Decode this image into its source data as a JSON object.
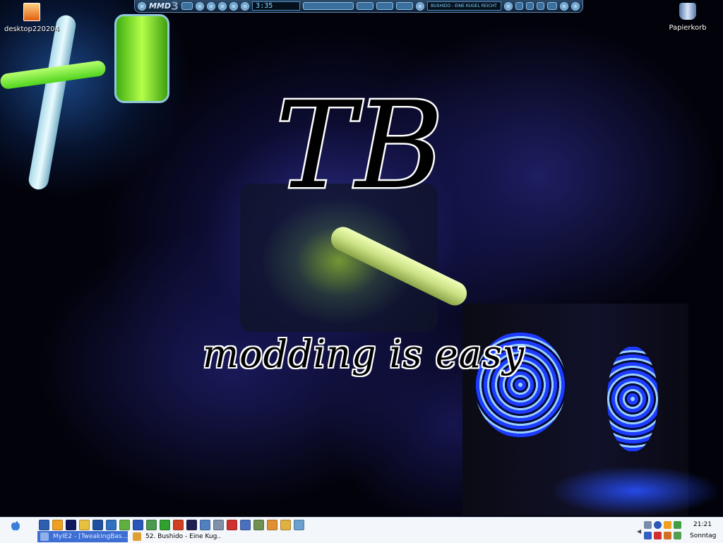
{
  "desktop": {
    "icons": [
      {
        "label": "desktop220204",
        "icon": "image-file-icon"
      },
      {
        "label": "Papierkorb",
        "icon": "recycle-bin-icon"
      }
    ]
  },
  "wallpaper": {
    "logo_text": "TB",
    "motto": "modding is easy"
  },
  "media_player": {
    "logo": "MMD",
    "version": "3",
    "time": "3:35",
    "track": "BUSHIDO - EINE KUGEL REICHT"
  },
  "taskbar": {
    "tasks": [
      {
        "label": "MyIE2 - [TweakingBas...",
        "active": true
      },
      {
        "label": "52. Bushido - Eine Kug...",
        "active": false
      }
    ],
    "clock": {
      "time": "21:21",
      "day": "Sonntag"
    }
  },
  "colors": {
    "taskbar_bg": "#f3f6fb",
    "active_task": "#3d6ed3",
    "player_bg": "#1a3350",
    "fan_blue": "#1d3cff"
  }
}
